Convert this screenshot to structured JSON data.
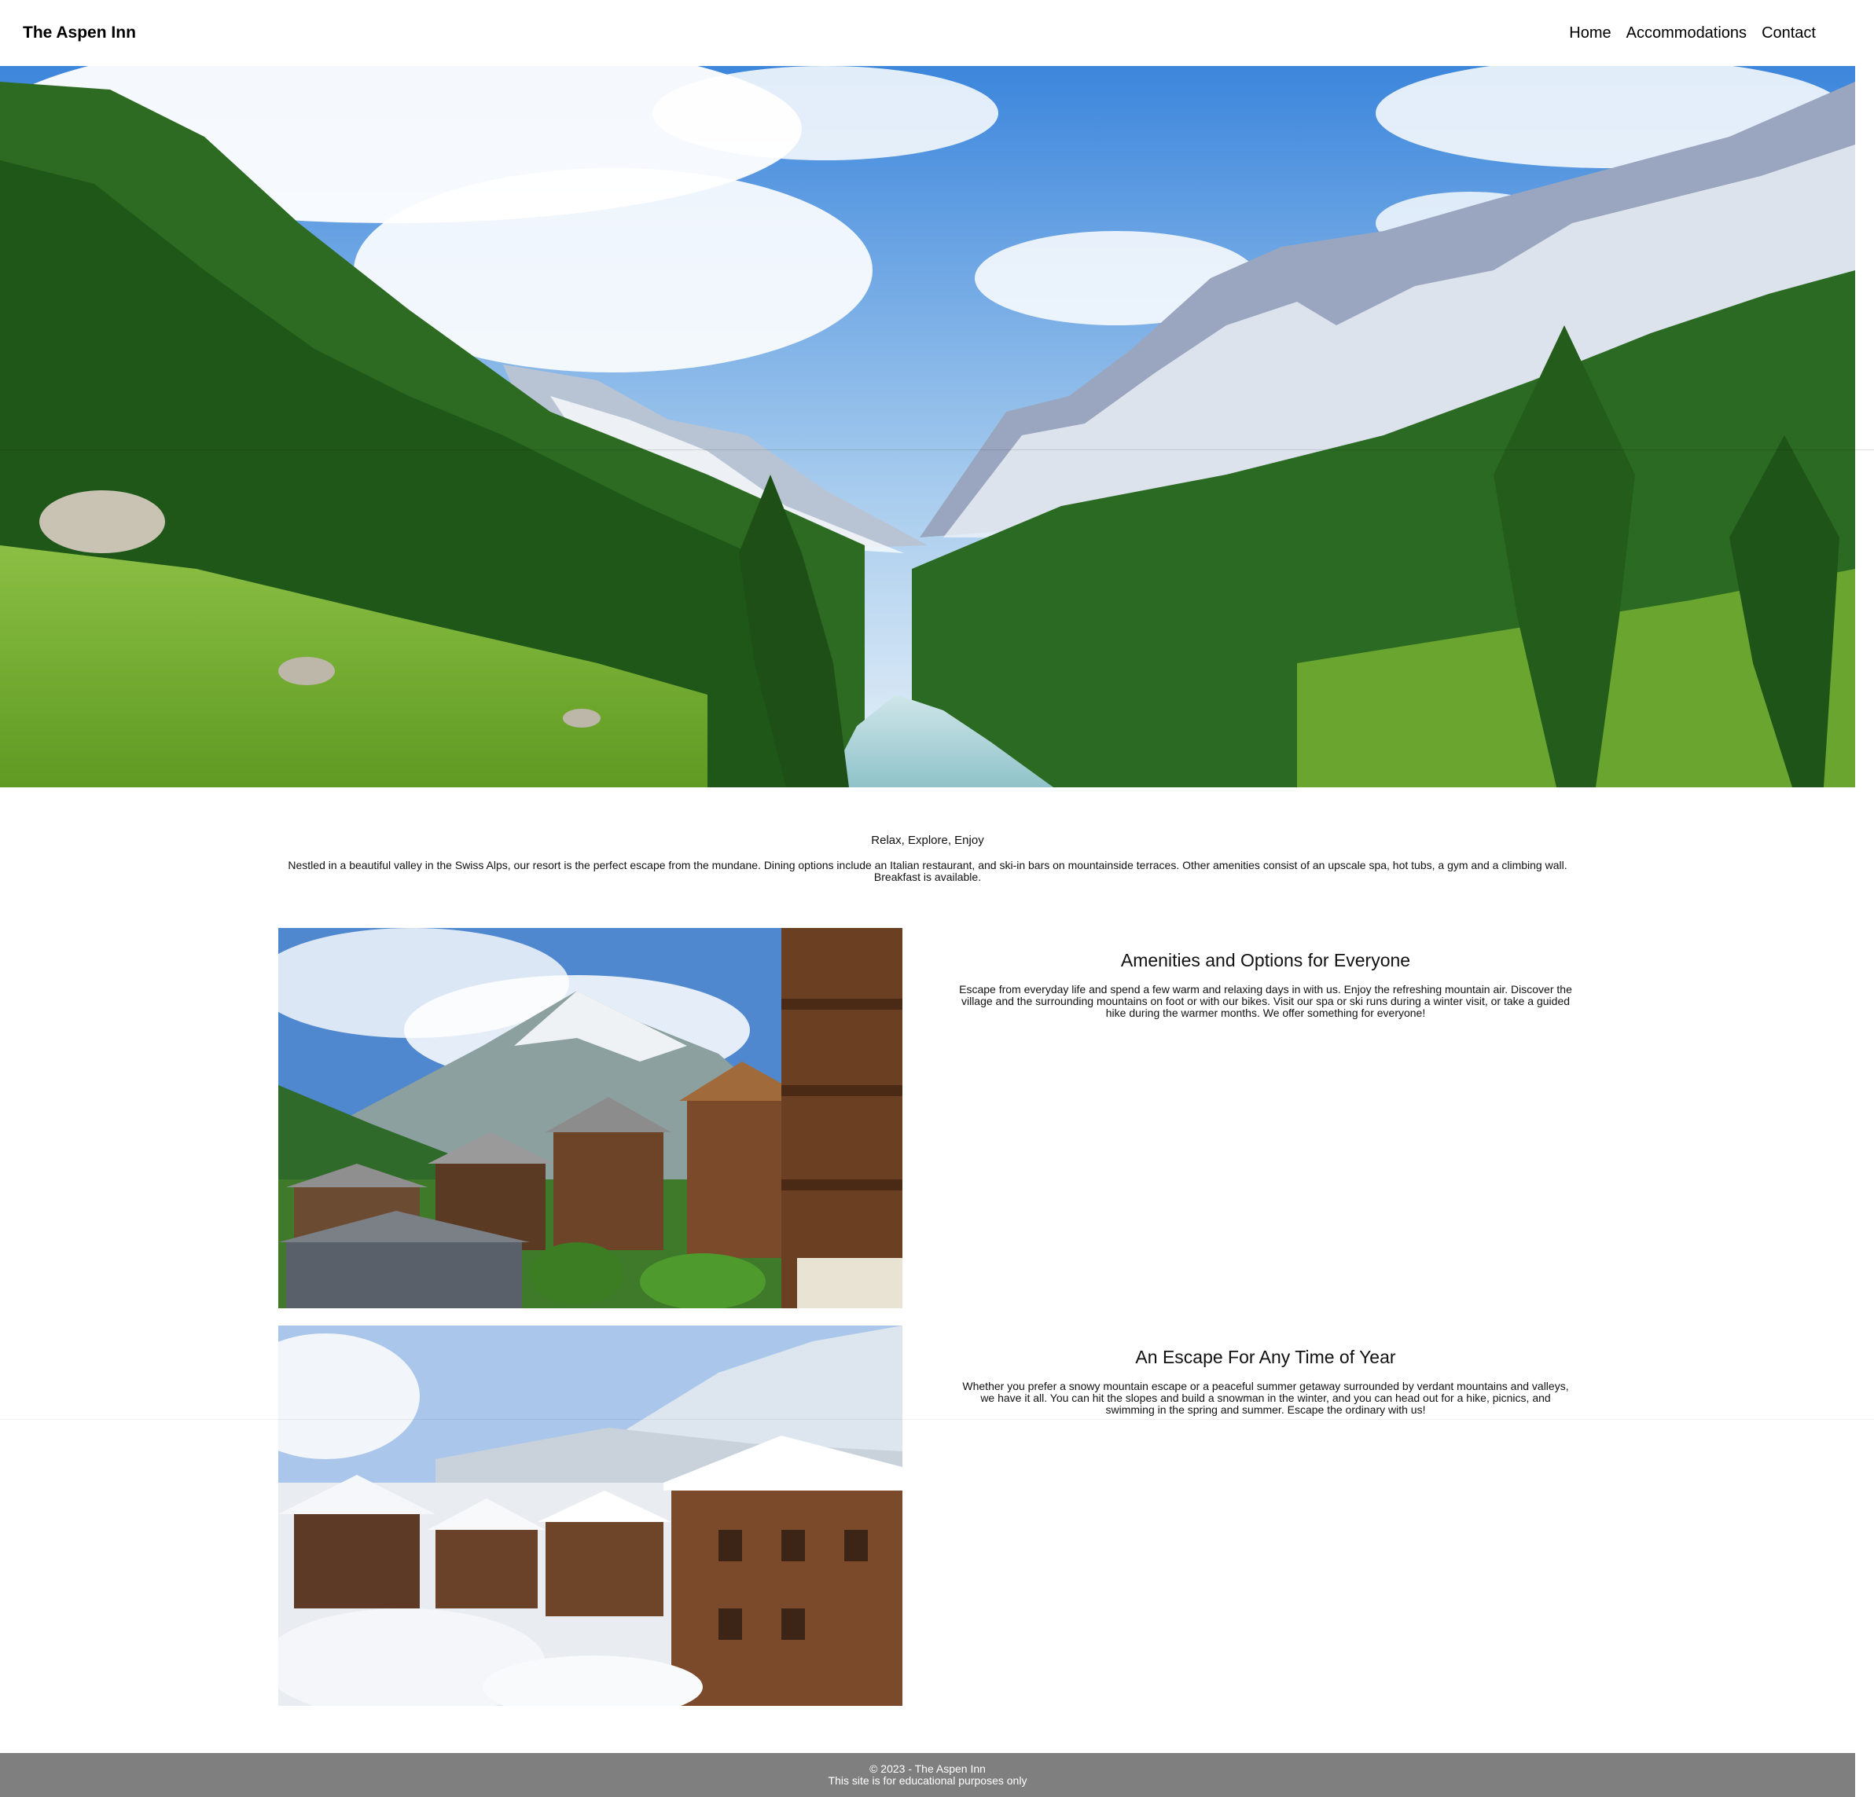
{
  "header": {
    "brand": "The Aspen Inn",
    "nav": [
      "Home",
      "Accommodations",
      "Contact"
    ]
  },
  "intro": {
    "tagline": "Relax, Explore, Enjoy",
    "text": "Nestled in a beautiful valley in the Swiss Alps, our resort is the perfect escape from the mundane. Dining options include an Italian restaurant, and ski-in bars on mountainside terraces. Other amenities consist of an upscale spa, hot tubs, a gym and a climbing wall. Breakfast is available."
  },
  "features": [
    {
      "title": "Amenities and Options for Everyone",
      "text": "Escape from everyday life and spend a few warm and relaxing days in with us. Enjoy the refreshing mountain air. Discover the village and the surrounding mountains on foot or with our bikes. Visit our spa or ski runs during a winter visit, or take a guided hike during the warmer months. We offer something for everyone!"
    },
    {
      "title": "An Escape For Any Time of Year",
      "text": "Whether you prefer a snowy mountain escape or a peaceful summer getaway surrounded by verdant mountains and valleys, we have it all. You can hit the slopes and build a snowman in the winter, and you can head out for a hike, picnics, and swimming in the spring and summer. Escape the ordinary with us!"
    }
  ],
  "footer": {
    "copyright": "© 2023 - The Aspen Inn",
    "note": "This site is for educational purposes only"
  },
  "colors": {
    "footer_bg": "#7f7f7f",
    "sky": "#4f8fd8",
    "forest": "#2f6a1f"
  }
}
